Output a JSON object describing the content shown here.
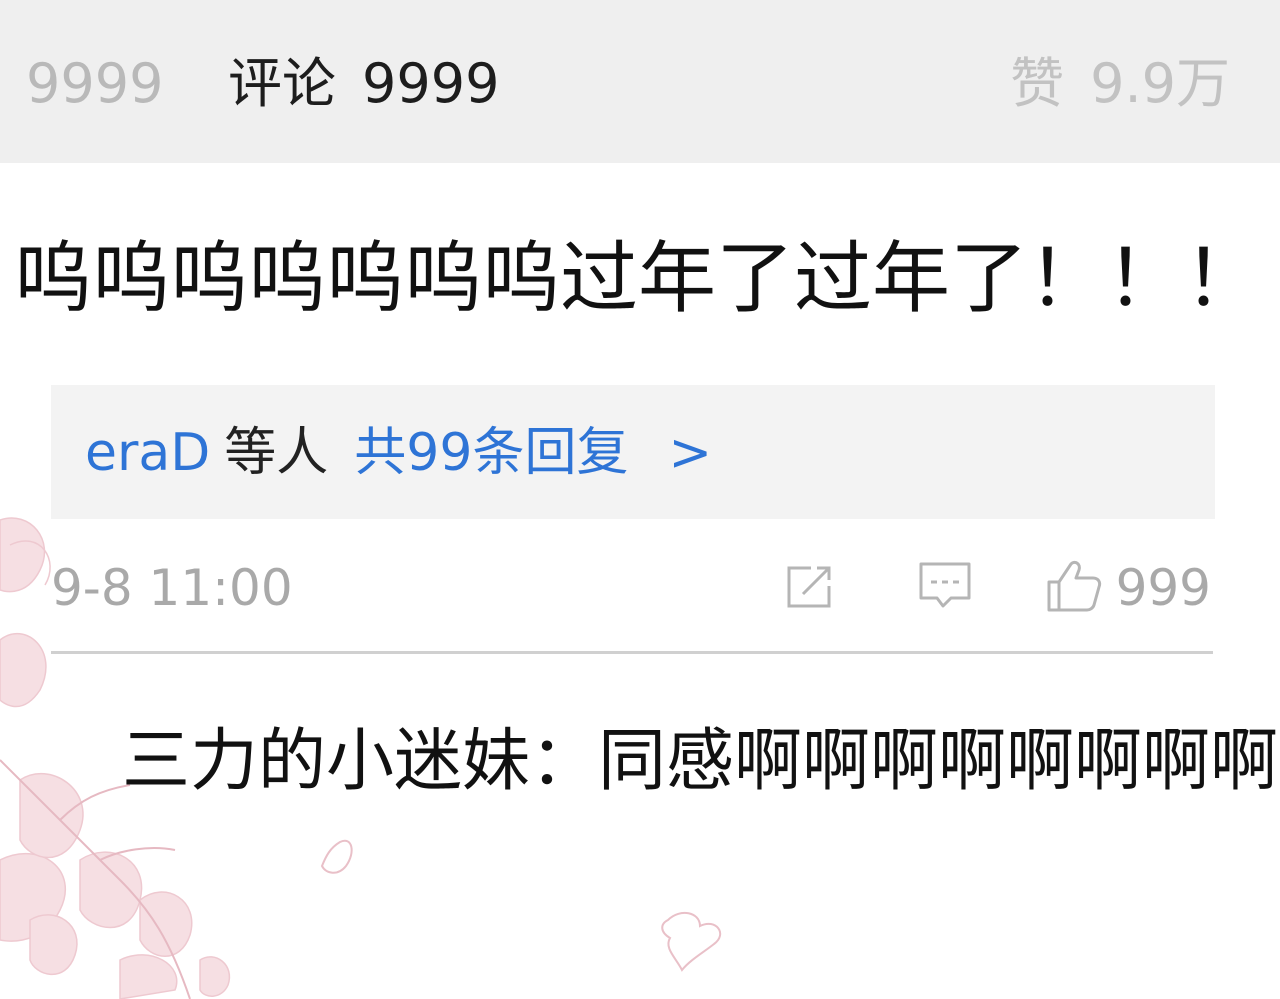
{
  "header": {
    "left_count": "9999",
    "comments_label": "评论",
    "comments_count": "9999",
    "likes_label": "赞",
    "likes_count": "9.9万"
  },
  "comment": {
    "text": "呜呜呜呜呜呜呜过年了过年了！！！"
  },
  "replies": {
    "user": "eraD",
    "others_label": "等人",
    "count_label": "共99条回复",
    "arrow": ">"
  },
  "meta": {
    "time": "9-8 11:00",
    "like_count": "999"
  },
  "sub_comment": {
    "author": "三力的小迷妹：",
    "text": "同感啊啊啊啊啊啊啊啊"
  },
  "colors": {
    "header_bg": "#efefef",
    "link_blue": "#2e74d6",
    "muted_gray": "#a9a9a9",
    "reply_box_bg": "#f3f3f3"
  }
}
